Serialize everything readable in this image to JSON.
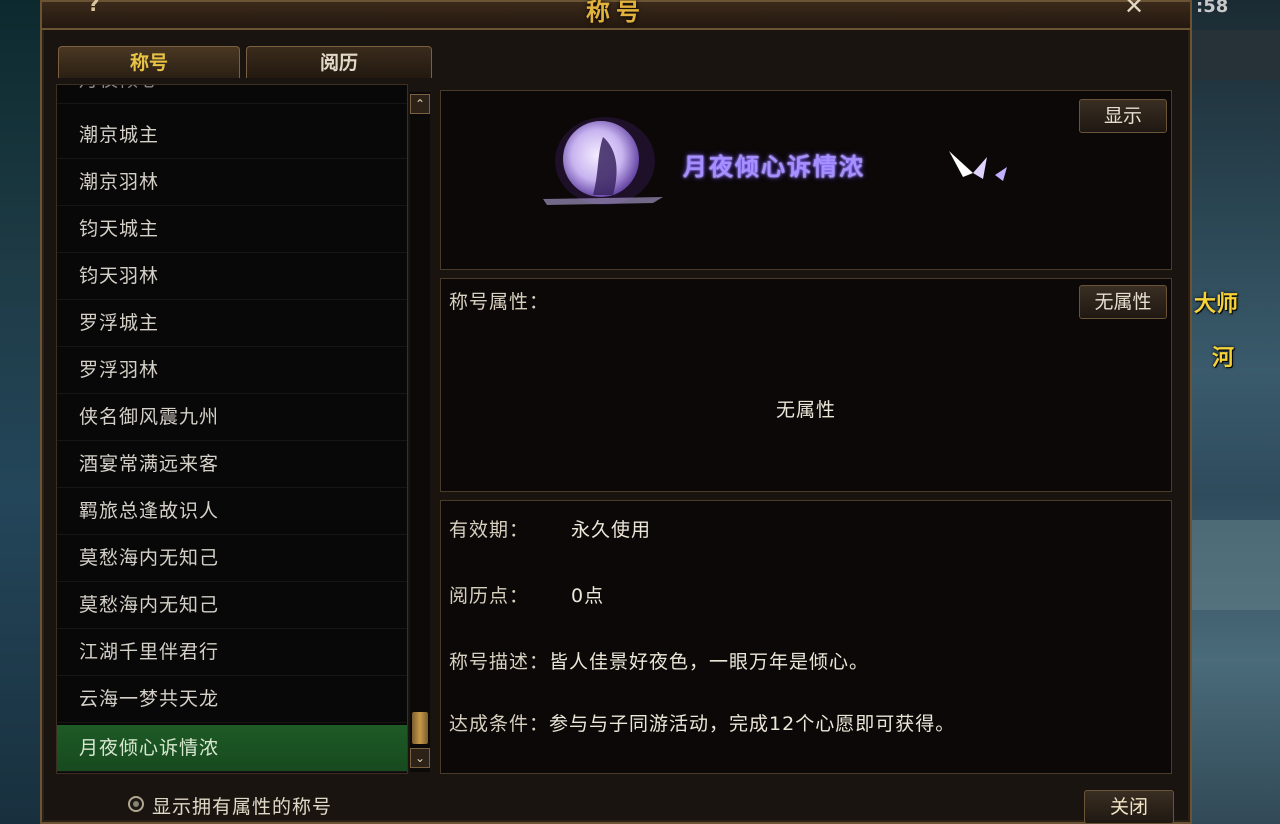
{
  "window": {
    "title": "称号",
    "help": "?",
    "close": "✕"
  },
  "background": {
    "clock": ":58",
    "npc_line1": "大师",
    "npc_line2": "河"
  },
  "tabs": [
    {
      "label": "称号",
      "active": true
    },
    {
      "label": "阅历",
      "active": false
    }
  ],
  "title_list": {
    "items": [
      {
        "label": "月夜倾心",
        "partial": true
      },
      {
        "label": "潮京城主"
      },
      {
        "label": "潮京羽林"
      },
      {
        "label": "钧天城主"
      },
      {
        "label": "钧天羽林"
      },
      {
        "label": "罗浮城主"
      },
      {
        "label": "罗浮羽林"
      },
      {
        "label": "侠名御风震九州"
      },
      {
        "label": "酒宴常满远来客"
      },
      {
        "label": "羁旅总逢故识人"
      },
      {
        "label": "莫愁海内无知己"
      },
      {
        "label": "莫愁海内无知己"
      },
      {
        "label": "江湖千里伴君行"
      },
      {
        "label": "云海一梦共天龙"
      },
      {
        "label": "月夜倾心诉情浓",
        "selected": true
      }
    ]
  },
  "display_panel": {
    "show_button": "显示",
    "badge_text": "月夜倾心诉情浓"
  },
  "attributes": {
    "label": "称号属性：",
    "button": "无属性",
    "value": "无属性"
  },
  "info": {
    "validity_label": "有效期：",
    "validity_value": "永久使用",
    "points_label": "阅历点：",
    "points_value": "0点",
    "desc_label": "称号描述：",
    "desc_value": "皆人佳景好夜色，一眼万年是倾心。",
    "cond_label": "达成条件：",
    "cond_value": "参与与子同游活动，完成12个心愿即可获得。"
  },
  "footer": {
    "checkbox_label": "显示拥有属性的称号",
    "close_button": "关闭"
  },
  "colors": {
    "gold": "#e3b23c",
    "selected_row": "#1e5a26",
    "badge_purple": "#a590ff"
  }
}
